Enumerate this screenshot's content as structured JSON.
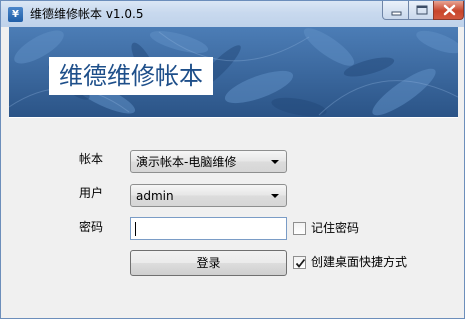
{
  "window": {
    "title": "维德维修帐本 v1.0.5",
    "icon_glyph": "¥"
  },
  "banner": {
    "heading": "维德维修帐本",
    "color": "#2f5d94"
  },
  "form": {
    "account_label": "帐本",
    "account_value": "演示帐本-电脑维修",
    "user_label": "用户",
    "user_value": "admin",
    "password_label": "密码",
    "password_value": "",
    "remember_label": "记住密码",
    "remember_checked": false,
    "shortcut_label": "创建桌面快捷方式",
    "shortcut_checked": true,
    "login_label": "登录"
  },
  "icons": [
    "minimize-icon",
    "maximize-icon",
    "close-icon",
    "app-icon",
    "chevron-down-icon",
    "checkmark-icon"
  ]
}
